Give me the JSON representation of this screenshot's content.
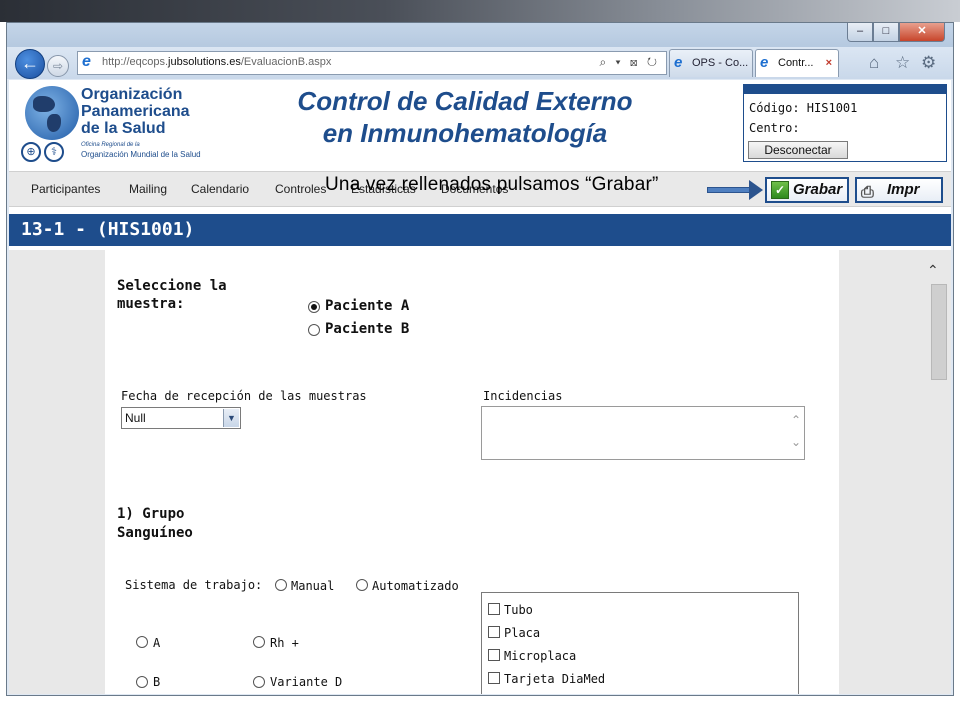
{
  "browser": {
    "url_prefix": "http://eqcops.",
    "url_domain": "jubsolutions.es",
    "url_path": "/EvaluacionB.aspx",
    "address_tools": "⌕ ▾ ⊠ ↻",
    "tabs": [
      {
        "label": "OPS - Co..."
      },
      {
        "label": "Contr...",
        "close": "×"
      }
    ],
    "window_controls": {
      "min": "–",
      "max": "□",
      "close": "✕"
    },
    "icons": {
      "back": "←",
      "forward": "⇨",
      "home": "⌂",
      "favorites": "☆",
      "tools": "⚙",
      "ie": "e"
    }
  },
  "header": {
    "org_name": "Organización\nPanamericana\nde la Salud",
    "org_office": "Oficina Regional de la",
    "org_who": "Organización Mundial de la Salud",
    "title_line1": "Control de Calidad Externo",
    "title_line2": "en Inmunohematología",
    "code_label": "Código: HIS1001",
    "center_label": "Centro:",
    "disconnect_label": "Desconectar"
  },
  "menu": {
    "items": [
      "Participantes",
      "Mailing",
      "Calendario",
      "Controles",
      "Estadísticas",
      "Documentos"
    ],
    "annotation": "Una vez rellenados pulsamos “Grabar”",
    "save_label": "Grabar",
    "print_label": "Impr"
  },
  "section_title": "13-1 - (HIS1001)",
  "form": {
    "sample_label": "Seleccione la\nmuestra:",
    "sample_options": [
      {
        "label": "Paciente A",
        "checked": true
      },
      {
        "label": "Paciente B",
        "checked": false
      }
    ],
    "date_label": "Fecha de recepción de las muestras",
    "date_value": "Null",
    "incidents_label": "Incidencias",
    "blood_group_title": "1) Grupo\nSanguíneo",
    "work_system_label": "Sistema de trabajo:",
    "work_system_options": [
      "Manual",
      "Automatizado"
    ],
    "group_options": [
      "A",
      "Rh +",
      "B",
      "Variante D"
    ],
    "methods": [
      "Tubo",
      "Placa",
      "Microplaca",
      "Tarjeta DiaMed"
    ]
  }
}
